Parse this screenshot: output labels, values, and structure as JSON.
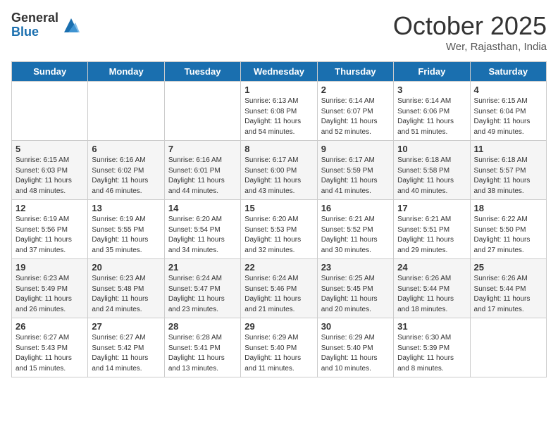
{
  "header": {
    "logo_general": "General",
    "logo_blue": "Blue",
    "month_title": "October 2025",
    "subtitle": "Wer, Rajasthan, India"
  },
  "days_of_week": [
    "Sunday",
    "Monday",
    "Tuesday",
    "Wednesday",
    "Thursday",
    "Friday",
    "Saturday"
  ],
  "weeks": [
    [
      {
        "day": "",
        "info": ""
      },
      {
        "day": "",
        "info": ""
      },
      {
        "day": "",
        "info": ""
      },
      {
        "day": "1",
        "info": "Sunrise: 6:13 AM\nSunset: 6:08 PM\nDaylight: 11 hours\nand 54 minutes."
      },
      {
        "day": "2",
        "info": "Sunrise: 6:14 AM\nSunset: 6:07 PM\nDaylight: 11 hours\nand 52 minutes."
      },
      {
        "day": "3",
        "info": "Sunrise: 6:14 AM\nSunset: 6:06 PM\nDaylight: 11 hours\nand 51 minutes."
      },
      {
        "day": "4",
        "info": "Sunrise: 6:15 AM\nSunset: 6:04 PM\nDaylight: 11 hours\nand 49 minutes."
      }
    ],
    [
      {
        "day": "5",
        "info": "Sunrise: 6:15 AM\nSunset: 6:03 PM\nDaylight: 11 hours\nand 48 minutes."
      },
      {
        "day": "6",
        "info": "Sunrise: 6:16 AM\nSunset: 6:02 PM\nDaylight: 11 hours\nand 46 minutes."
      },
      {
        "day": "7",
        "info": "Sunrise: 6:16 AM\nSunset: 6:01 PM\nDaylight: 11 hours\nand 44 minutes."
      },
      {
        "day": "8",
        "info": "Sunrise: 6:17 AM\nSunset: 6:00 PM\nDaylight: 11 hours\nand 43 minutes."
      },
      {
        "day": "9",
        "info": "Sunrise: 6:17 AM\nSunset: 5:59 PM\nDaylight: 11 hours\nand 41 minutes."
      },
      {
        "day": "10",
        "info": "Sunrise: 6:18 AM\nSunset: 5:58 PM\nDaylight: 11 hours\nand 40 minutes."
      },
      {
        "day": "11",
        "info": "Sunrise: 6:18 AM\nSunset: 5:57 PM\nDaylight: 11 hours\nand 38 minutes."
      }
    ],
    [
      {
        "day": "12",
        "info": "Sunrise: 6:19 AM\nSunset: 5:56 PM\nDaylight: 11 hours\nand 37 minutes."
      },
      {
        "day": "13",
        "info": "Sunrise: 6:19 AM\nSunset: 5:55 PM\nDaylight: 11 hours\nand 35 minutes."
      },
      {
        "day": "14",
        "info": "Sunrise: 6:20 AM\nSunset: 5:54 PM\nDaylight: 11 hours\nand 34 minutes."
      },
      {
        "day": "15",
        "info": "Sunrise: 6:20 AM\nSunset: 5:53 PM\nDaylight: 11 hours\nand 32 minutes."
      },
      {
        "day": "16",
        "info": "Sunrise: 6:21 AM\nSunset: 5:52 PM\nDaylight: 11 hours\nand 30 minutes."
      },
      {
        "day": "17",
        "info": "Sunrise: 6:21 AM\nSunset: 5:51 PM\nDaylight: 11 hours\nand 29 minutes."
      },
      {
        "day": "18",
        "info": "Sunrise: 6:22 AM\nSunset: 5:50 PM\nDaylight: 11 hours\nand 27 minutes."
      }
    ],
    [
      {
        "day": "19",
        "info": "Sunrise: 6:23 AM\nSunset: 5:49 PM\nDaylight: 11 hours\nand 26 minutes."
      },
      {
        "day": "20",
        "info": "Sunrise: 6:23 AM\nSunset: 5:48 PM\nDaylight: 11 hours\nand 24 minutes."
      },
      {
        "day": "21",
        "info": "Sunrise: 6:24 AM\nSunset: 5:47 PM\nDaylight: 11 hours\nand 23 minutes."
      },
      {
        "day": "22",
        "info": "Sunrise: 6:24 AM\nSunset: 5:46 PM\nDaylight: 11 hours\nand 21 minutes."
      },
      {
        "day": "23",
        "info": "Sunrise: 6:25 AM\nSunset: 5:45 PM\nDaylight: 11 hours\nand 20 minutes."
      },
      {
        "day": "24",
        "info": "Sunrise: 6:26 AM\nSunset: 5:44 PM\nDaylight: 11 hours\nand 18 minutes."
      },
      {
        "day": "25",
        "info": "Sunrise: 6:26 AM\nSunset: 5:44 PM\nDaylight: 11 hours\nand 17 minutes."
      }
    ],
    [
      {
        "day": "26",
        "info": "Sunrise: 6:27 AM\nSunset: 5:43 PM\nDaylight: 11 hours\nand 15 minutes."
      },
      {
        "day": "27",
        "info": "Sunrise: 6:27 AM\nSunset: 5:42 PM\nDaylight: 11 hours\nand 14 minutes."
      },
      {
        "day": "28",
        "info": "Sunrise: 6:28 AM\nSunset: 5:41 PM\nDaylight: 11 hours\nand 13 minutes."
      },
      {
        "day": "29",
        "info": "Sunrise: 6:29 AM\nSunset: 5:40 PM\nDaylight: 11 hours\nand 11 minutes."
      },
      {
        "day": "30",
        "info": "Sunrise: 6:29 AM\nSunset: 5:40 PM\nDaylight: 11 hours\nand 10 minutes."
      },
      {
        "day": "31",
        "info": "Sunrise: 6:30 AM\nSunset: 5:39 PM\nDaylight: 11 hours\nand 8 minutes."
      },
      {
        "day": "",
        "info": ""
      }
    ]
  ]
}
